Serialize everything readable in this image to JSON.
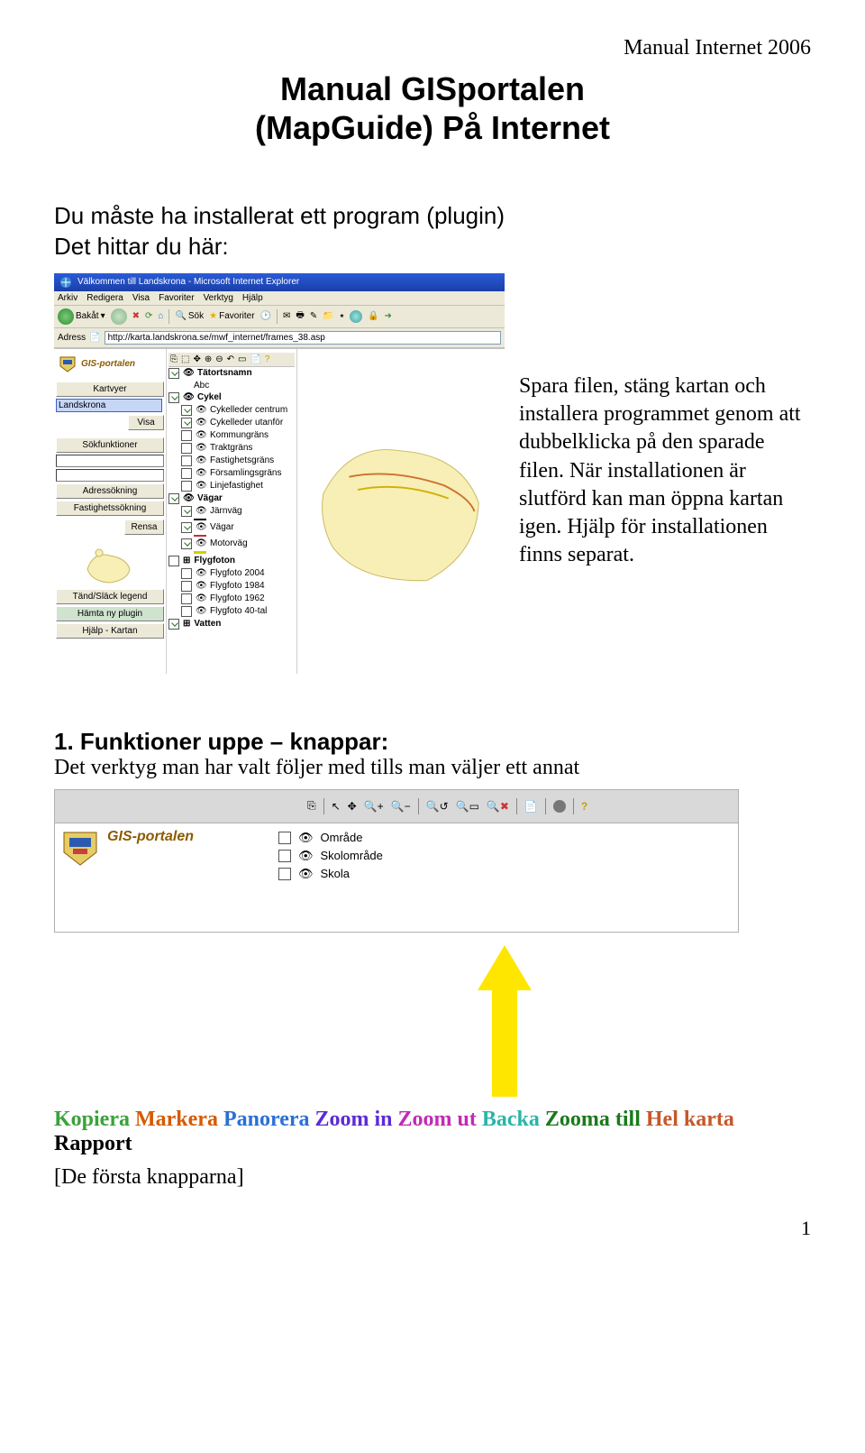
{
  "header": {
    "right": "Manual Internet 2006"
  },
  "title": {
    "line1": "Manual GISportalen",
    "line2": "(MapGuide) På Internet"
  },
  "intro": {
    "line1": "Du måste ha installerat ett program (plugin)",
    "line2": "Det hittar du här:"
  },
  "ie": {
    "window_title": "Välkommen till Landskrona - Microsoft Internet Explorer",
    "menu": {
      "arkiv": "Arkiv",
      "redigera": "Redigera",
      "visa": "Visa",
      "favoriter": "Favoriter",
      "verktyg": "Verktyg",
      "hjalp": "Hjälp"
    },
    "toolbar": {
      "back": "Bakåt",
      "sok": "Sök",
      "fav": "Favoriter"
    },
    "address_label": "Adress",
    "url": "http://karta.landskrona.se/mwf_internet/frames_38.asp"
  },
  "gis": {
    "brand": "GIS-portalen",
    "sideA": {
      "kartvyer": "Kartvyer",
      "landkrona_sel": "Landskrona",
      "visa": "Visa",
      "sokfunktioner": "Sökfunktioner",
      "adressokning": "Adressökning",
      "fastighetssokning": "Fastighetssökning",
      "rensa": "Rensa",
      "tand": "Tänd/Släck legend",
      "hamta": "Hämta ny plugin",
      "hjalp": "Hjälp - Kartan"
    },
    "layers": {
      "tatortsnamn": "Tätortsnamn",
      "abc": "Abc",
      "cykel": "Cykel",
      "cykel_c": "Cykelleder centrum",
      "cykel_u": "Cykelleder utanför",
      "kommun": "Kommungräns",
      "trakt": "Traktgräns",
      "fastg": "Fastighetsgräns",
      "fors": "Församlingsgräns",
      "linje": "Linjefastighet",
      "vagar": "Vägar",
      "jarnvag": "Järnväg",
      "vagar2": "Vägar",
      "motorvag": "Motorväg",
      "flygfoton": "Flygfoton",
      "f2004": "Flygfoto 2004",
      "f1984": "Flygfoto 1984",
      "f1962": "Flygfoto 1962",
      "f40": "Flygfoto 40-tal",
      "vatten": "Vatten"
    }
  },
  "side_text": "Spara filen, stäng kartan och installera programmet genom att dubbelklicka på den sparade filen. När installationen är slutförd kan man öppna kartan igen. Hjälp för installationen finns separat.",
  "section1": {
    "num": "1.",
    "title": "Funktioner uppe – knappar:",
    "sub": "Det verktyg man har valt följer med tills man väljer ett annat"
  },
  "fig2": {
    "brand": "GIS-portalen",
    "layers": {
      "omrade": "Område",
      "skolomrade": "Skolområde",
      "skola": "Skola"
    }
  },
  "legend": {
    "kopiera": "Kopiera",
    "markera": "Markera",
    "panorera": "Panorera",
    "zoomin": "Zoom in",
    "zoomut": "Zoom ut",
    "backa": "Backa",
    "zoomatill": "Zooma till",
    "helkarta": "Hel karta",
    "rapport": "Rapport"
  },
  "end": "[De första knapparna]",
  "pagenum": "1"
}
